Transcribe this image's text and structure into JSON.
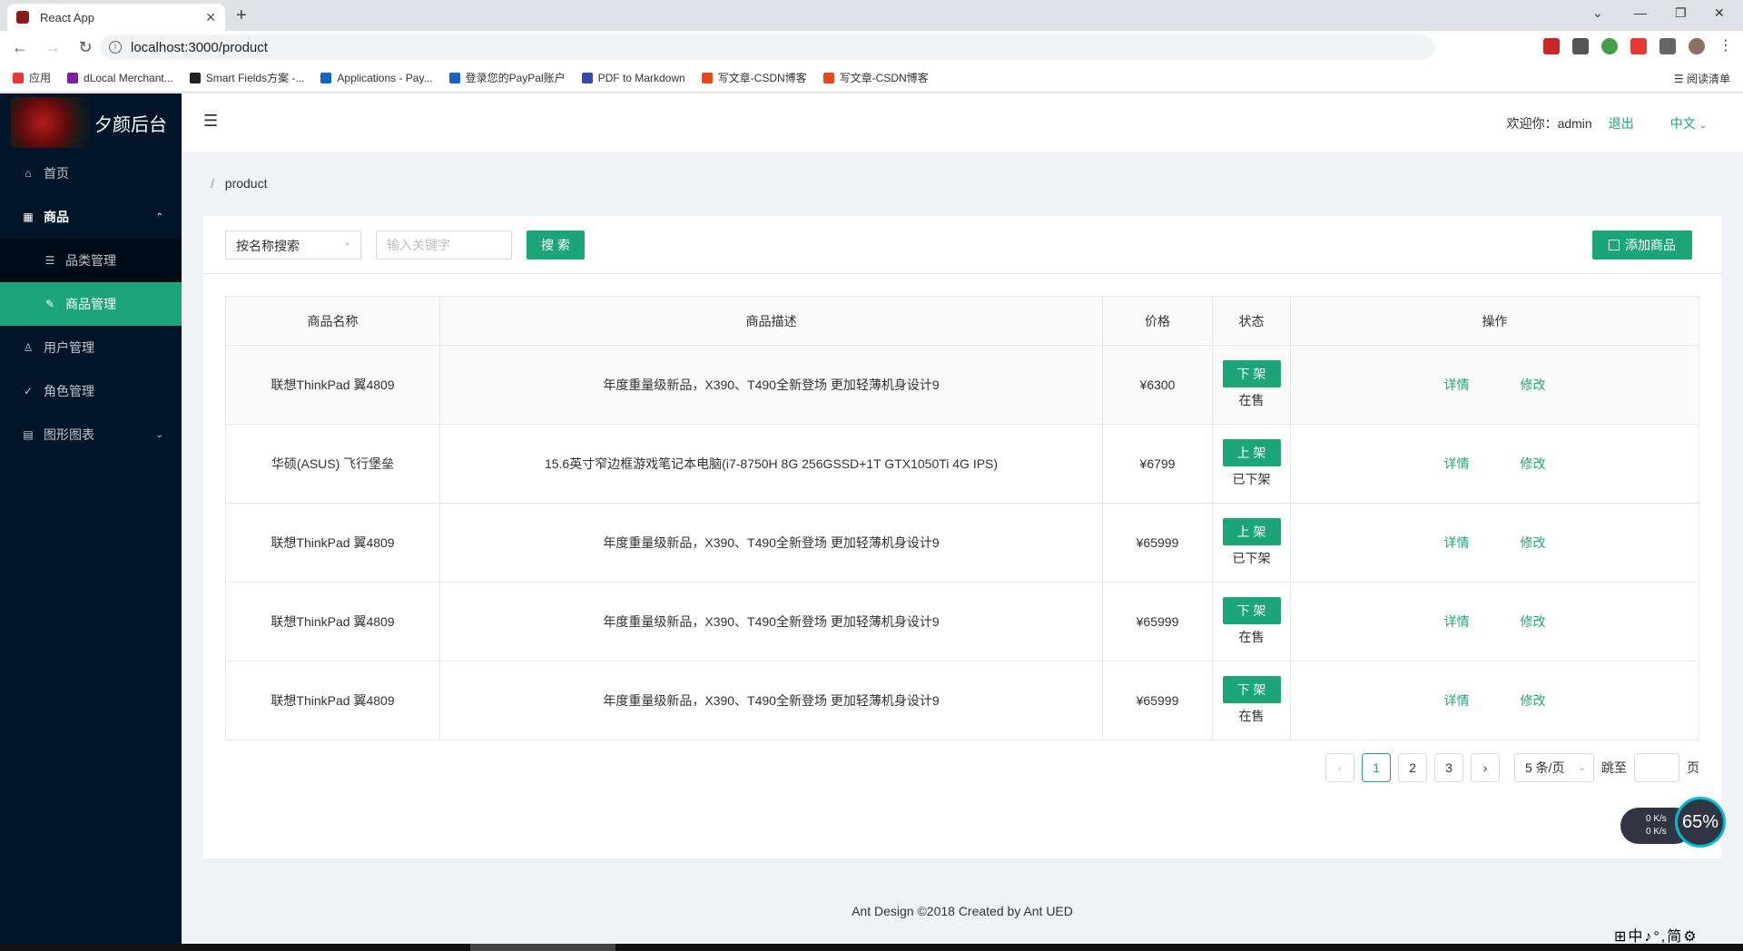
{
  "browser": {
    "tab_title": "React App",
    "url": "localhost:3000/product",
    "bookmarks": [
      {
        "label": "应用",
        "color": "#e53935"
      },
      {
        "label": "dLocal Merchant...",
        "color": "#7b1fa2"
      },
      {
        "label": "Smart Fields方案 -...",
        "color": "#222222"
      },
      {
        "label": "Applications - Pay...",
        "color": "#1565c0"
      },
      {
        "label": "登录您的PayPal账户",
        "color": "#1565c0"
      },
      {
        "label": "PDF to Markdown",
        "color": "#3949ab"
      },
      {
        "label": "写文章-CSDN博客",
        "color": "#e64a19"
      },
      {
        "label": "写文章-CSDN博客",
        "color": "#e64a19"
      }
    ],
    "reading_list": "阅读清单"
  },
  "sidebar": {
    "app_title": "夕颜后台",
    "items": [
      {
        "label": "首页",
        "icon": "home-icon",
        "glyph": "⌂"
      },
      {
        "label": "商品",
        "icon": "appstore-icon",
        "glyph": "▦"
      },
      {
        "label": "品类管理",
        "icon": "bars-icon",
        "glyph": "☰"
      },
      {
        "label": "商品管理",
        "icon": "tool-icon",
        "glyph": "✎"
      },
      {
        "label": "用户管理",
        "icon": "user-icon",
        "glyph": "♙"
      },
      {
        "label": "角色管理",
        "icon": "safety-icon",
        "glyph": "✓"
      },
      {
        "label": "图形图表",
        "icon": "area-chart-icon",
        "glyph": "▤"
      }
    ]
  },
  "header": {
    "welcome": "欢迎你：admin",
    "logout": "退出",
    "language": "中文"
  },
  "breadcrumb": {
    "separator": "/",
    "current": "product"
  },
  "toolbar": {
    "search_type": "按名称搜索",
    "keyword_placeholder": "输入关键字",
    "search_label": "搜 索",
    "add_label": "添加商品"
  },
  "table": {
    "columns": [
      "商品名称",
      "商品描述",
      "价格",
      "状态",
      "操作"
    ],
    "rows": [
      {
        "name": "联想ThinkPad 翼4809",
        "desc": "年度重量级新品，X390、T490全新登场 更加轻薄机身设计9",
        "price": "¥6300",
        "action": "下 架",
        "status": "在售",
        "detail": "详情",
        "edit": "修改"
      },
      {
        "name": "华硕(ASUS) 飞行堡垒",
        "desc": "15.6英寸窄边框游戏笔记本电脑(i7-8750H 8G 256GSSD+1T GTX1050Ti 4G IPS)",
        "price": "¥6799",
        "action": "上 架",
        "status": "已下架",
        "detail": "详情",
        "edit": "修改"
      },
      {
        "name": "联想ThinkPad 翼4809",
        "desc": "年度重量级新品，X390、T490全新登场 更加轻薄机身设计9",
        "price": "¥65999",
        "action": "上 架",
        "status": "已下架",
        "detail": "详情",
        "edit": "修改"
      },
      {
        "name": "联想ThinkPad 翼4809",
        "desc": "年度重量级新品，X390、T490全新登场 更加轻薄机身设计9",
        "price": "¥65999",
        "action": "下 架",
        "status": "在售",
        "detail": "详情",
        "edit": "修改"
      },
      {
        "name": "联想ThinkPad 翼4809",
        "desc": "年度重量级新品，X390、T490全新登场 更加轻薄机身设计9",
        "price": "¥65999",
        "action": "下 架",
        "status": "在售",
        "detail": "详情",
        "edit": "修改"
      }
    ]
  },
  "pagination": {
    "pages": [
      "1",
      "2",
      "3"
    ],
    "current": "1",
    "page_size": "5 条/页",
    "jump_label": "跳至",
    "page_suffix": "页"
  },
  "footer": "Ant Design ©2018 Created by Ant UED",
  "speed_widget": {
    "up": "0 K/s",
    "down": "0 K/s",
    "percent": "65%"
  },
  "ime": "⊞中♪°,简⚙",
  "colors": {
    "primary": "#1da57a",
    "sider": "#001529"
  }
}
